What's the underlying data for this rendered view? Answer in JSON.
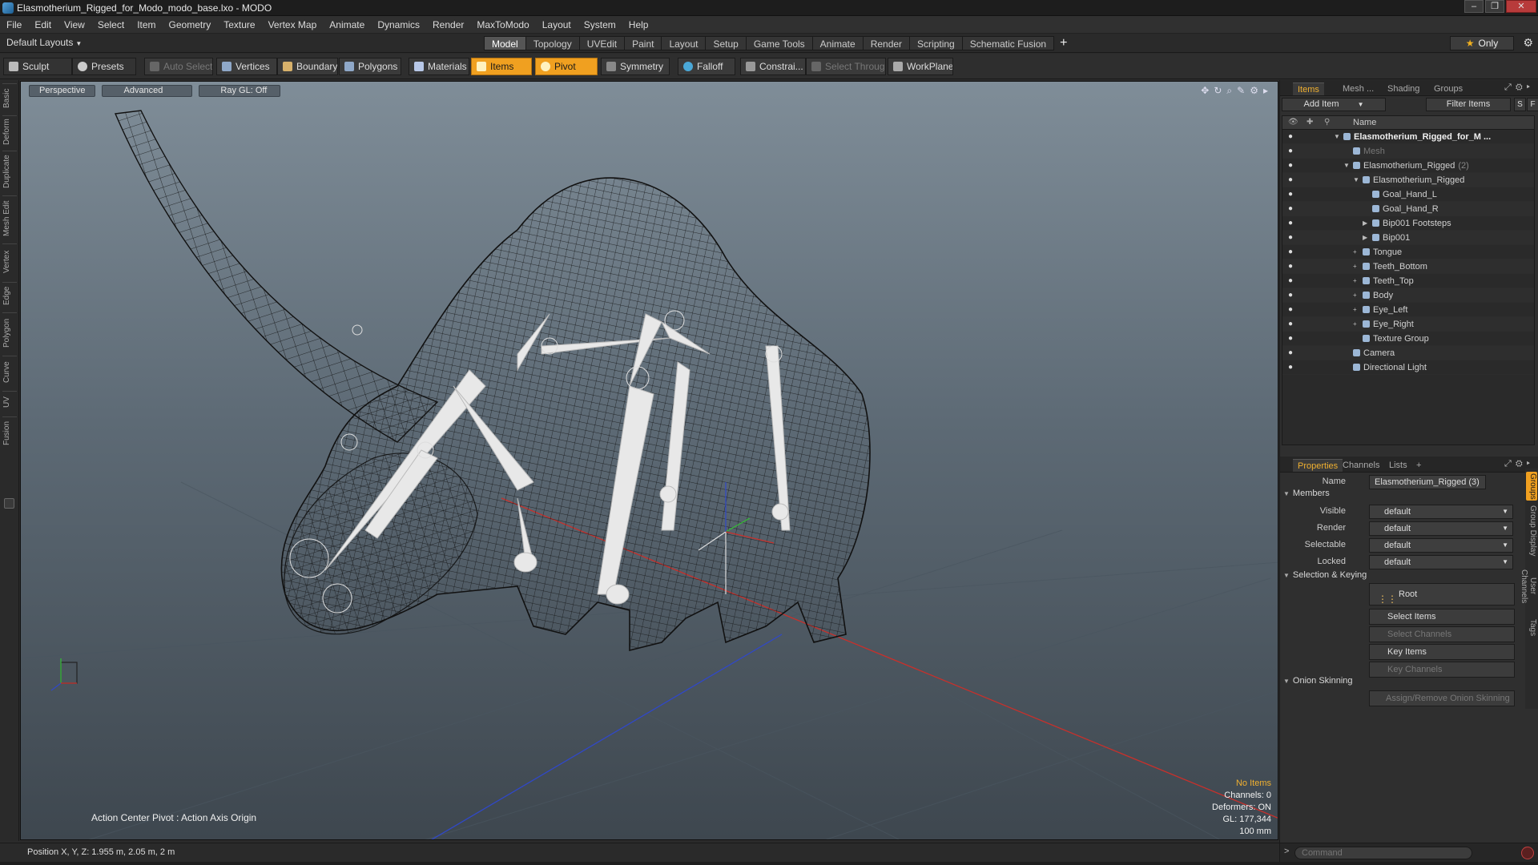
{
  "window": {
    "title": "Elasmotherium_Rigged_for_Modo_modo_base.lxo - MODO",
    "min": "–",
    "max": "❐",
    "close": "✕"
  },
  "menu": [
    "File",
    "Edit",
    "View",
    "Select",
    "Item",
    "Geometry",
    "Texture",
    "Vertex Map",
    "Animate",
    "Dynamics",
    "Render",
    "MaxToModo",
    "Layout",
    "System",
    "Help"
  ],
  "layout_bar": {
    "layouts_label": "Default Layouts",
    "tabs": [
      "Model",
      "Topology",
      "UVEdit",
      "Paint",
      "Layout",
      "Setup",
      "Game Tools",
      "Animate",
      "Render",
      "Scripting",
      "Schematic Fusion"
    ],
    "active_tab": "Model",
    "plus": "+",
    "only_label": "Only",
    "only_star": "★"
  },
  "toolbar": {
    "sculpt": "Sculpt",
    "presets": "Presets",
    "auto_select": "Auto Select",
    "vertices": "Vertices",
    "boundary": "Boundary",
    "polygons": "Polygons",
    "materials": "Materials",
    "items": "Items",
    "pivot": "Pivot",
    "symmetry": "Symmetry",
    "falloff": "Falloff",
    "constraints": "Constrai...",
    "select_through": "Select Through",
    "workplane": "WorkPlane"
  },
  "left_tabs": [
    "Basic",
    "Deform",
    "Duplicate",
    "Mesh Edit",
    "Vertex",
    "Edge",
    "Polygon",
    "Curve",
    "UV",
    "Fusion"
  ],
  "viewport": {
    "perspective": "Perspective",
    "advanced": "Advanced",
    "raygl": "Ray GL: Off",
    "action_center": "Action Center Pivot : Action Axis Origin",
    "hud": {
      "no_items": "No Items",
      "channels": "Channels: 0",
      "deformers": "Deformers: ON",
      "gl": "GL: 177,344",
      "scale": "100 mm"
    }
  },
  "status": {
    "position": "Position X, Y, Z:  1.955 m, 2.05 m, 2 m"
  },
  "items_panel": {
    "tabs": [
      "Items",
      "Mesh ...",
      "Shading",
      "Groups"
    ],
    "active_tab": "Items",
    "add_item": "Add Item",
    "filter_items": "Filter Items",
    "s_btn": "S",
    "f_btn": "F",
    "col_name": "Name",
    "tree": [
      {
        "label": "Elasmotherium_Rigged_for_M ...",
        "indent": 0,
        "expander": "▼",
        "bold": true
      },
      {
        "label": "Mesh",
        "indent": 1,
        "expander": "",
        "dim": true
      },
      {
        "label": "Elasmotherium_Rigged",
        "count": "(2)",
        "indent": 1,
        "expander": "▼"
      },
      {
        "label": "Elasmotherium_Rigged",
        "indent": 2,
        "expander": "▼"
      },
      {
        "label": "Goal_Hand_L",
        "indent": 3,
        "expander": ""
      },
      {
        "label": "Goal_Hand_R",
        "indent": 3,
        "expander": ""
      },
      {
        "label": "Bip001 Footsteps",
        "indent": 3,
        "expander": "▶"
      },
      {
        "label": "Bip001",
        "indent": 3,
        "expander": "▶"
      },
      {
        "label": "Tongue",
        "indent": 2,
        "expander": "+"
      },
      {
        "label": "Teeth_Bottom",
        "indent": 2,
        "expander": "+"
      },
      {
        "label": "Teeth_Top",
        "indent": 2,
        "expander": "+"
      },
      {
        "label": "Body",
        "indent": 2,
        "expander": "+"
      },
      {
        "label": "Eye_Left",
        "indent": 2,
        "expander": "+"
      },
      {
        "label": "Eye_Right",
        "indent": 2,
        "expander": "+"
      },
      {
        "label": "Texture Group",
        "indent": 2,
        "expander": ""
      },
      {
        "label": "Camera",
        "indent": 1,
        "expander": ""
      },
      {
        "label": "Directional Light",
        "indent": 1,
        "expander": ""
      }
    ]
  },
  "properties": {
    "tabs": [
      "Properties",
      "Channels",
      "Lists"
    ],
    "active_tab": "Properties",
    "plus": "+",
    "name_label": "Name",
    "name_value": "Elasmotherium_Rigged (3)",
    "members": "Members",
    "visible_label": "Visible",
    "visible_value": "default",
    "render_label": "Render",
    "render_value": "default",
    "selectable_label": "Selectable",
    "selectable_value": "default",
    "locked_label": "Locked",
    "locked_value": "default",
    "selection_keying": "Selection & Keying",
    "root": "Root",
    "select_items": "Select Items",
    "select_channels": "Select Channels",
    "key_items": "Key Items",
    "key_channels": "Key Channels",
    "onion": "Onion Skinning",
    "assign_onion": "Assign/Remove Onion Skinning",
    "side_tabs": [
      "Groups",
      "Group Display",
      "User Channels",
      "Tags"
    ]
  },
  "command": {
    "placeholder": "Command"
  },
  "colors": {
    "accent": "#f0a020",
    "viewport_top": "#7f8d98",
    "viewport_bottom": "#3e474f"
  }
}
